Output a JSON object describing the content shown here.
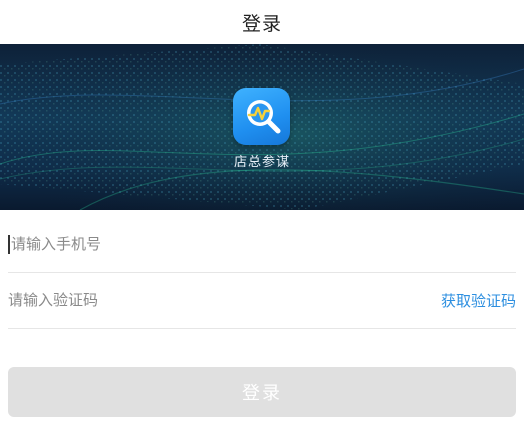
{
  "nav": {
    "title": "登录"
  },
  "banner": {
    "app_name": "店总参谋"
  },
  "form": {
    "phone_placeholder": "请输入手机号",
    "code_placeholder": "请输入验证码",
    "get_code_label": "获取验证码",
    "login_label": "登录"
  },
  "colors": {
    "accent": "#2d8fe0",
    "button_disabled": "#e0e0e0",
    "banner_dark": "#0e2138"
  }
}
